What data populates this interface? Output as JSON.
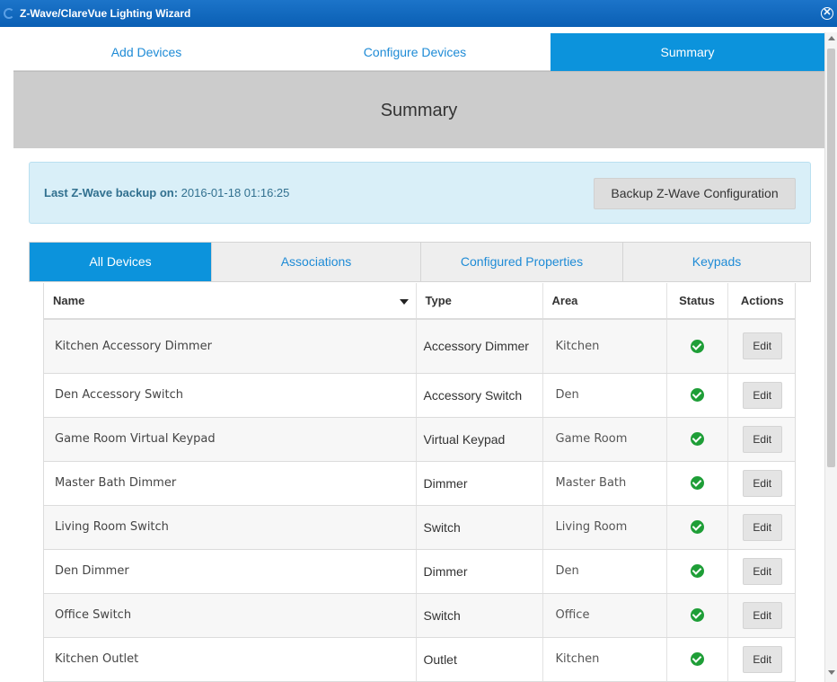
{
  "window": {
    "title": "Z-Wave/ClareVue Lighting Wizard"
  },
  "wizard_tabs": [
    {
      "label": "Add Devices",
      "active": false
    },
    {
      "label": "Configure Devices",
      "active": false
    },
    {
      "label": "Summary",
      "active": true
    }
  ],
  "summary": {
    "title": "Summary"
  },
  "backup": {
    "label": "Last Z-Wave backup on:",
    "value": "2016-01-18 01:16:25",
    "button_label": "Backup Z-Wave Configuration"
  },
  "sub_tabs": [
    {
      "label": "All Devices",
      "active": true
    },
    {
      "label": "Associations",
      "active": false
    },
    {
      "label": "Configured Properties",
      "active": false
    },
    {
      "label": "Keypads",
      "active": false
    }
  ],
  "table": {
    "columns": [
      "Name",
      "Type",
      "Area",
      "Status",
      "Actions"
    ],
    "rows": [
      {
        "name": "Kitchen Accessory Dimmer",
        "type": "Accessory Dimmer",
        "area": "Kitchen",
        "status": "ok",
        "action": "Edit"
      },
      {
        "name": "Den Accessory Switch",
        "type": "Accessory Switch",
        "area": "Den",
        "status": "ok",
        "action": "Edit"
      },
      {
        "name": "Game Room Virtual Keypad",
        "type": "Virtual Keypad",
        "area": "Game Room",
        "status": "ok",
        "action": "Edit"
      },
      {
        "name": "Master Bath Dimmer",
        "type": "Dimmer",
        "area": "Master Bath",
        "status": "ok",
        "action": "Edit"
      },
      {
        "name": "Living Room Switch",
        "type": "Switch",
        "area": "Living Room",
        "status": "ok",
        "action": "Edit"
      },
      {
        "name": "Den Dimmer",
        "type": "Dimmer",
        "area": "Den",
        "status": "ok",
        "action": "Edit"
      },
      {
        "name": "Office Switch",
        "type": "Switch",
        "area": "Office",
        "status": "ok",
        "action": "Edit"
      },
      {
        "name": "Kitchen Outlet",
        "type": "Outlet",
        "area": "Kitchen",
        "status": "ok",
        "action": "Edit"
      }
    ]
  },
  "colors": {
    "accent": "#0c93dc",
    "title_bar": "#0a5fb4",
    "status_ok": "#1e9e37",
    "info_bg": "#d9eff8"
  },
  "icons": {
    "close": "close-circle-icon",
    "status": "check-circle-icon",
    "sort": "caret-down-icon"
  }
}
